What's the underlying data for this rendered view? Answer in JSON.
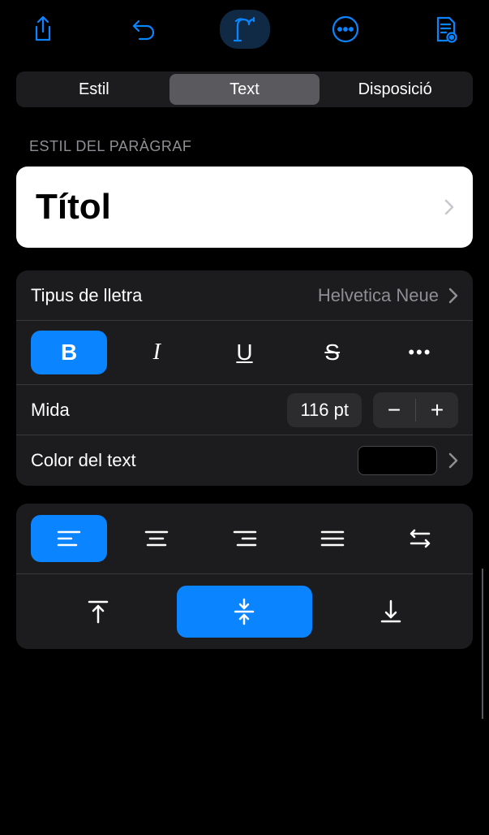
{
  "toolbar": {
    "share": "share",
    "undo": "undo",
    "format": "format",
    "more": "more",
    "document": "document"
  },
  "tabs": {
    "style": "Estil",
    "text": "Text",
    "layout": "Disposició"
  },
  "paragraph": {
    "header": "Estil del paràgraf",
    "value": "Títol"
  },
  "font": {
    "label": "Tipus de lletra",
    "value": "Helvetica Neue",
    "bold": "B",
    "italic": "I",
    "underline": "U",
    "strike": "S",
    "more": "•••"
  },
  "size": {
    "label": "Mida",
    "value": "116 pt",
    "minus": "−",
    "plus": "+"
  },
  "textcolor": {
    "label": "Color del text",
    "value": "#000000"
  }
}
